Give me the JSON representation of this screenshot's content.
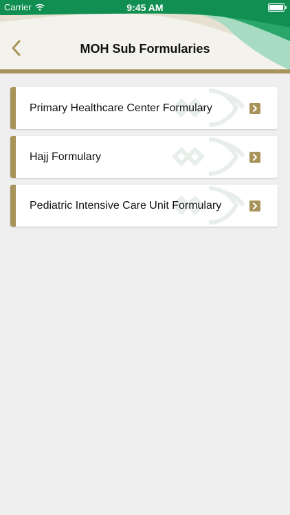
{
  "status_bar": {
    "carrier": "Carrier",
    "time": "9:45 AM"
  },
  "header": {
    "title": "MOH Sub Formularies"
  },
  "items": [
    {
      "label": "Primary Healthcare Center Formulary"
    },
    {
      "label": "Hajj Formulary"
    },
    {
      "label": "Pediatric Intensive Care Unit Formulary"
    }
  ],
  "colors": {
    "brand_green": "#118f52",
    "accent_gold": "#a8935a",
    "background": "#efefef"
  }
}
